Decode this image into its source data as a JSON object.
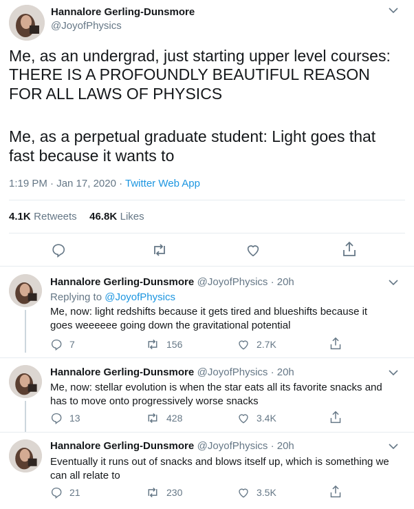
{
  "main_tweet": {
    "author_name": "Hannalore Gerling-Dunsmore",
    "author_handle": "@JoyofPhysics",
    "text_p1_line1": "Me, as an undergrad, just starting upper level courses:",
    "text_p1_line2": "THERE IS A PROFOUNDLY BEAUTIFUL REASON",
    "text_p1_line3": "FOR ALL LAWS OF PHYSICS",
    "text_p2_line1": "Me, as a perpetual graduate student: Light goes that",
    "text_p2_line2": "fast because it wants to",
    "time": "1:19 PM · Jan 17, 2020 · ",
    "client": "Twitter Web App",
    "retweets_count": "4.1K",
    "retweets_label": "Retweets",
    "likes_count": "46.8K",
    "likes_label": "Likes"
  },
  "replies": [
    {
      "author_name": "Hannalore Gerling-Dunsmore",
      "handle_time": "@JoyofPhysics · 20h",
      "replying_prefix": "Replying to ",
      "replying_handle": "@JoyofPhysics",
      "line1": "Me, now: light redshifts because it gets tired and blueshifts because it",
      "line2": "goes weeeeee going down the gravitational potential",
      "reply_count": "7",
      "retweet_count": "156",
      "like_count": "2.7K"
    },
    {
      "author_name": "Hannalore Gerling-Dunsmore",
      "handle_time": "@JoyofPhysics · 20h",
      "line1": "Me, now: stellar evolution is when the star eats all its favorite snacks and",
      "line2": "has to move onto progressively worse snacks",
      "reply_count": "13",
      "retweet_count": "428",
      "like_count": "3.4K"
    },
    {
      "author_name": "Hannalore Gerling-Dunsmore",
      "handle_time": "@JoyofPhysics · 20h",
      "line1": "Eventually it runs out of snacks and blows itself up, which is something we",
      "line2": "can all relate to",
      "reply_count": "21",
      "retweet_count": "230",
      "like_count": "3.5K"
    }
  ],
  "colors": {
    "text": "#14171a",
    "secondary": "#657786",
    "link": "#1b95e0",
    "divider": "#e6ecf0"
  }
}
